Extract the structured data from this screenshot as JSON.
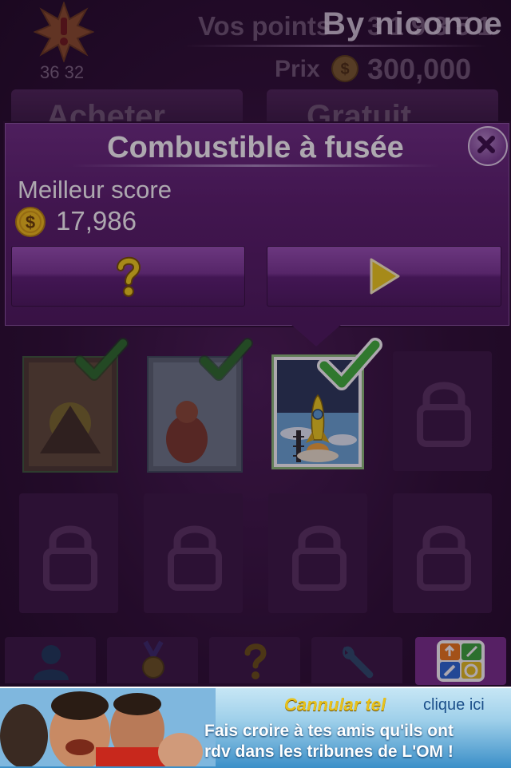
{
  "header": {
    "alert_count": "36 32",
    "points_label": "Vos points",
    "points_value": "3 1 9 3 5 1",
    "price_label": "Prix",
    "price_value": "300,000",
    "watermark": "By niconoe",
    "buy_label": "Acheter",
    "free_label": "Gratuit"
  },
  "dialog": {
    "title": "Combustible à fusée",
    "best_score_label": "Meilleur score",
    "best_score_value": "17,986",
    "help_icon": "question-mark-icon",
    "play_icon": "play-triangle-icon"
  },
  "grid": {
    "rows": 3,
    "cols": 4,
    "unlocked": [
      "card-1",
      "card-2",
      "card-3-rocket"
    ],
    "selected": "card-3-rocket"
  },
  "bottom_nav": {
    "items": [
      "profile-icon",
      "medal-icon",
      "help-icon",
      "wrench-icon",
      "more-apps-icon"
    ]
  },
  "ad": {
    "title": "Cannular tel",
    "link": "clique ici",
    "line1": "Fais croire à tes amis qu'ils ont",
    "line2": "rdv dans les tribunes de L'OM !"
  },
  "colors": {
    "dialog": "#5a1f6c",
    "check": "#3fb63a",
    "coin": "#f5c018",
    "play": "#f4d21a"
  }
}
